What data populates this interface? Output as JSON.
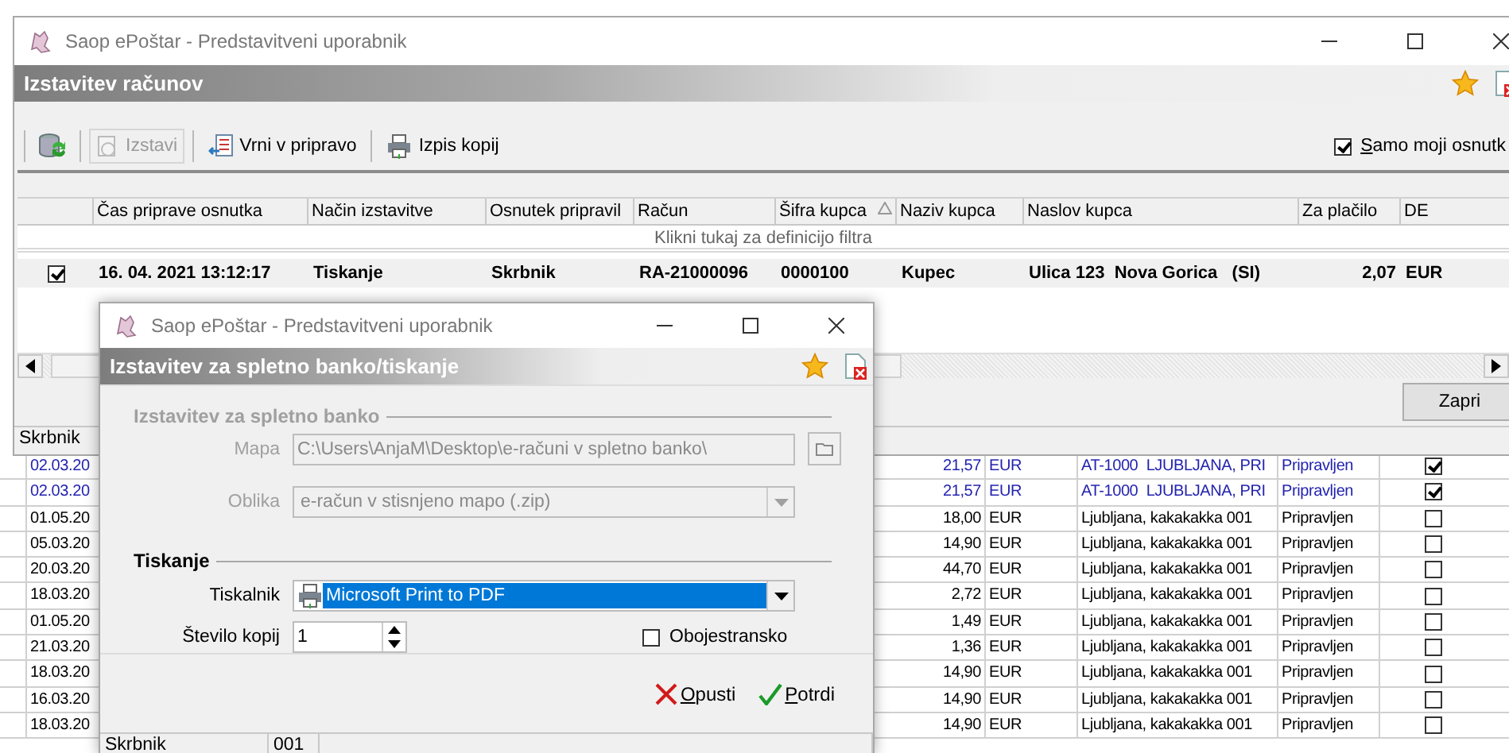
{
  "main_window": {
    "title": "Saop ePoštar - Predstavitveni uporabnik",
    "header": "Izstavitev računov",
    "toolbar": [
      {
        "label": "Izstavi",
        "disabled": true
      },
      {
        "label": "Vrni v pripravo",
        "disabled": false
      },
      {
        "label": "Izpis kopij",
        "disabled": false
      }
    ],
    "own_only": {
      "label": "Samo moji osnutk",
      "checked": true
    },
    "table": {
      "columns": [
        {
          "label": "Čas priprave osnutka",
          "sorted": false
        },
        {
          "label": "Način izstavitve",
          "sorted": false
        },
        {
          "label": "Osnutek pripravil",
          "sorted": false
        },
        {
          "label": "Račun",
          "sorted": false
        },
        {
          "label": "Šifra kupca",
          "sorted": true
        },
        {
          "label": "Naziv kupca",
          "sorted": false
        },
        {
          "label": "Naslov kupca",
          "sorted": false
        },
        {
          "label": "Za plačilo",
          "sorted": false
        },
        {
          "label": "DE",
          "sorted": false
        }
      ],
      "filter_hint": "Klikni tukaj za definicijo filtra",
      "rows": [
        {
          "checked": true,
          "cells": [
            "16. 04. 2021 13:12:17",
            "Tiskanje",
            "Skrbnik",
            "RA-21000096",
            "0000100",
            "Kupec",
            "Ulica 123  Nova Gorica   (SI)",
            "2,07",
            "EUR"
          ]
        }
      ]
    },
    "close_button": "Zapri",
    "status_bar": [
      "Skrbnik"
    ]
  },
  "dialog": {
    "title": "Saop ePoštar - Predstavitveni uporabnik",
    "header": "Izstavitev za spletno banko/tiskanje",
    "web_bank": {
      "title": "Izstavitev za spletno banko",
      "disabled": true,
      "folder": {
        "label": "Mapa",
        "value": "C:\\Users\\AnjaM\\Desktop\\e-računi v spletno banko\\"
      },
      "format": {
        "label": "Oblika",
        "value": "e-račun v stisnjeno mapo (.zip)"
      }
    },
    "printing": {
      "title": "Tiskanje",
      "printer": {
        "label": "Tiskalnik",
        "value": "Microsoft Print to PDF",
        "selected": true
      },
      "copies": {
        "label": "Število kopij",
        "value": "1"
      },
      "duplex": {
        "label": "Obojestransko",
        "checked": false
      }
    },
    "buttons": [
      {
        "label": "Opusti",
        "kind": "cancel"
      },
      {
        "label": "Potrdi",
        "kind": "ok"
      }
    ],
    "status_bar": [
      "Skrbnik",
      "001"
    ]
  },
  "background_list": {
    "rows": [
      {
        "date": "02.03.20",
        "amount": "21,57",
        "currency": "EUR",
        "address": "AT-1000  LJUBLJANA, PRI",
        "status": "Pripravljen",
        "checked": true,
        "highlighted": true
      },
      {
        "date": "02.03.20",
        "amount": "21,57",
        "currency": "EUR",
        "address": "AT-1000  LJUBLJANA, PRI",
        "status": "Pripravljen",
        "checked": true,
        "highlighted": true
      },
      {
        "date": "01.05.20",
        "amount": "18,00",
        "currency": "EUR",
        "address": "Ljubljana, kakakakka 001",
        "status": "Pripravljen",
        "checked": false,
        "highlighted": false
      },
      {
        "date": "05.03.20",
        "amount": "14,90",
        "currency": "EUR",
        "address": "Ljubljana, kakakakka 001",
        "status": "Pripravljen",
        "checked": false,
        "highlighted": false
      },
      {
        "date": "20.03.20",
        "amount": "44,70",
        "currency": "EUR",
        "address": "Ljubljana, kakakakka 001",
        "status": "Pripravljen",
        "checked": false,
        "highlighted": false
      },
      {
        "date": "18.03.20",
        "amount": "2,72",
        "currency": "EUR",
        "address": "Ljubljana, kakakakka 001",
        "status": "Pripravljen",
        "checked": false,
        "highlighted": false
      },
      {
        "date": "01.05.20",
        "amount": "1,49",
        "currency": "EUR",
        "address": "Ljubljana, kakakakka 001",
        "status": "Pripravljen",
        "checked": false,
        "highlighted": false
      },
      {
        "date": "21.03.20",
        "amount": "1,36",
        "currency": "EUR",
        "address": "Ljubljana, kakakakka 001",
        "status": "Pripravljen",
        "checked": false,
        "highlighted": false
      },
      {
        "date": "18.03.20",
        "amount": "14,90",
        "currency": "EUR",
        "address": "Ljubljana, kakakakka 001",
        "status": "Pripravljen",
        "checked": false,
        "highlighted": false
      },
      {
        "date": "16.03.20",
        "amount": "14,90",
        "currency": "EUR",
        "address": "Ljubljana, kakakakka 001",
        "status": "Pripravljen",
        "checked": false,
        "highlighted": false
      },
      {
        "date": "18.03.20",
        "amount": "14,90",
        "currency": "EUR",
        "address": "Ljubljana, kakakakka 001",
        "status": "Pripravljen",
        "checked": false,
        "highlighted": false
      }
    ]
  }
}
